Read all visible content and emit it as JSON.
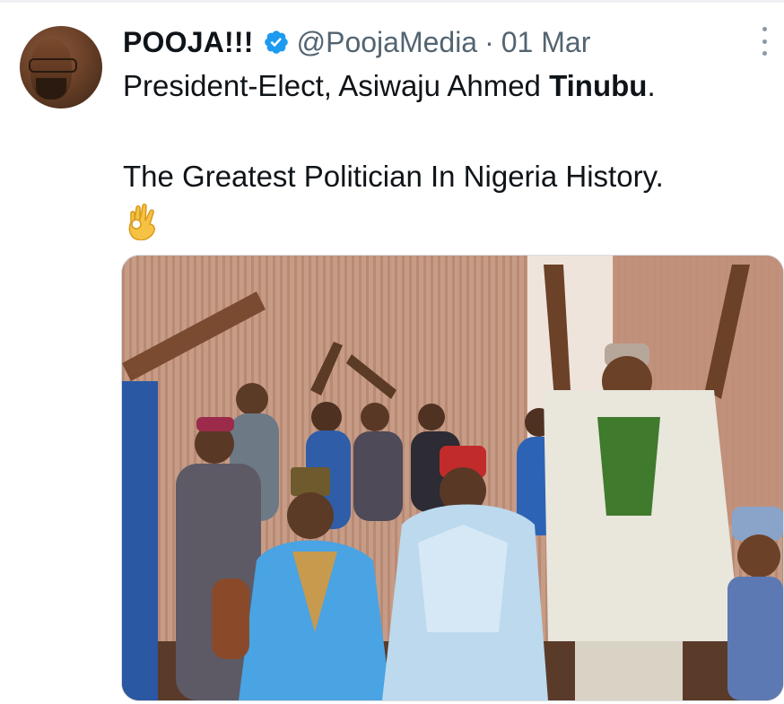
{
  "tweet": {
    "author_name": "POOJA!!!",
    "handle": "@PoojaMedia",
    "separator": "·",
    "date": "01 Mar",
    "text_line1_prefix": "President-Elect, Asiwaju Ahmed ",
    "text_line1_bold": "Tinubu",
    "text_line1_suffix": ".",
    "text_line2": "The Greatest Politician In Nigeria History.",
    "emoji": "ok-hand"
  },
  "icons": {
    "verified": "verified-badge-icon",
    "more": "more-options-icon"
  },
  "colors": {
    "verified_blue": "#1d9bf0",
    "secondary_text": "#536471",
    "primary_text": "#0f1419"
  }
}
